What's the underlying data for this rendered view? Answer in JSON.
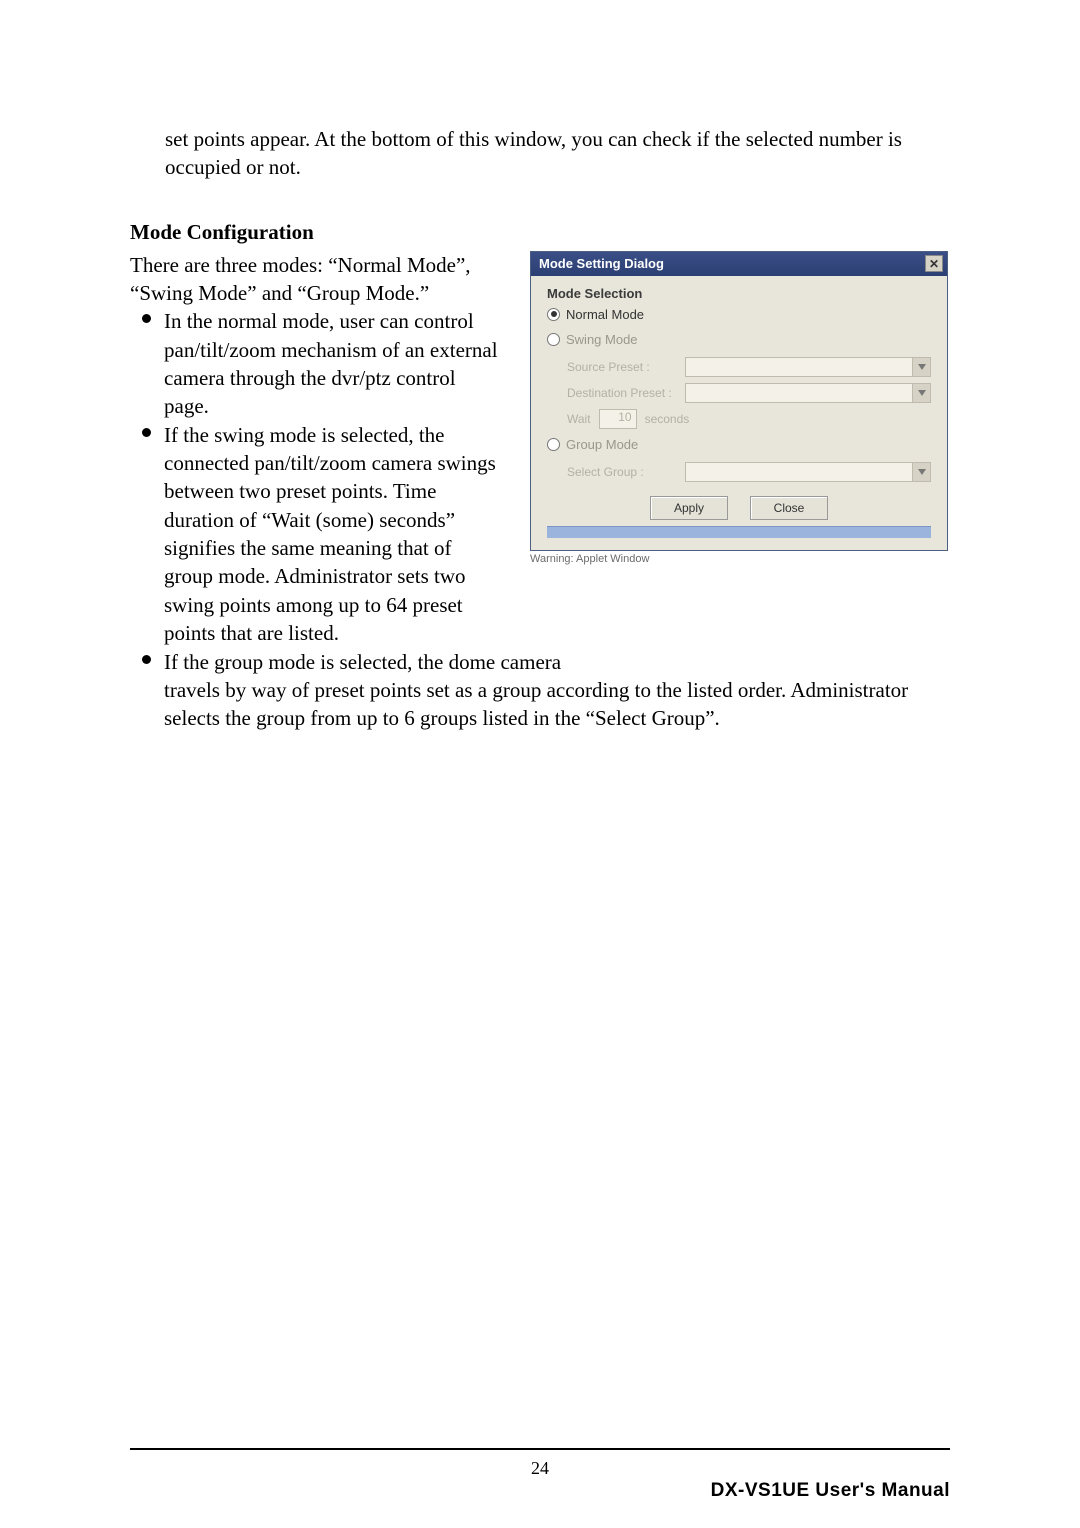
{
  "intro": "set points appear. At the bottom of this window, you can check if the selected number is occupied or not.",
  "section_title": "Mode Configuration",
  "modes_intro": "There are three modes: “Normal Mode”, “Swing Mode” and “Group Mode.”",
  "bullets": {
    "b1": "In the normal mode, user can control pan/tilt/zoom mechanism of an external camera through the dvr/ptz control page.",
    "b2": "If the swing mode is selected, the connected pan/tilt/zoom camera swings between two preset points. Time duration of “Wait (some) seconds” signifies the same meaning that of group mode. Administrator sets two swing points among up to 64 preset points that are listed.",
    "b3_line1": "If the group mode is selected, the dome camera",
    "b3_rest": "travels by way of preset points set as a group according to the listed order. Adminis­trator selects the group from up to 6 groups listed in the “Select Group”."
  },
  "dialog": {
    "title": "Mode Setting Dialog",
    "close_glyph": "✕",
    "heading": "Mode Selection",
    "normal_label": "Normal Mode",
    "swing_label": "Swing Mode",
    "swing_start": "Source Preset :",
    "swing_end": "Destination Preset :",
    "wait_label": "Wait",
    "wait_value": "10",
    "wait_suffix": "seconds",
    "group_label": "Group Mode",
    "group_select": "Select Group :",
    "apply": "Apply",
    "close": "Close",
    "applet_warning": "Warning: Applet Window"
  },
  "footer": {
    "page": "24",
    "manual": "DX-VS1UE User's Manual"
  }
}
